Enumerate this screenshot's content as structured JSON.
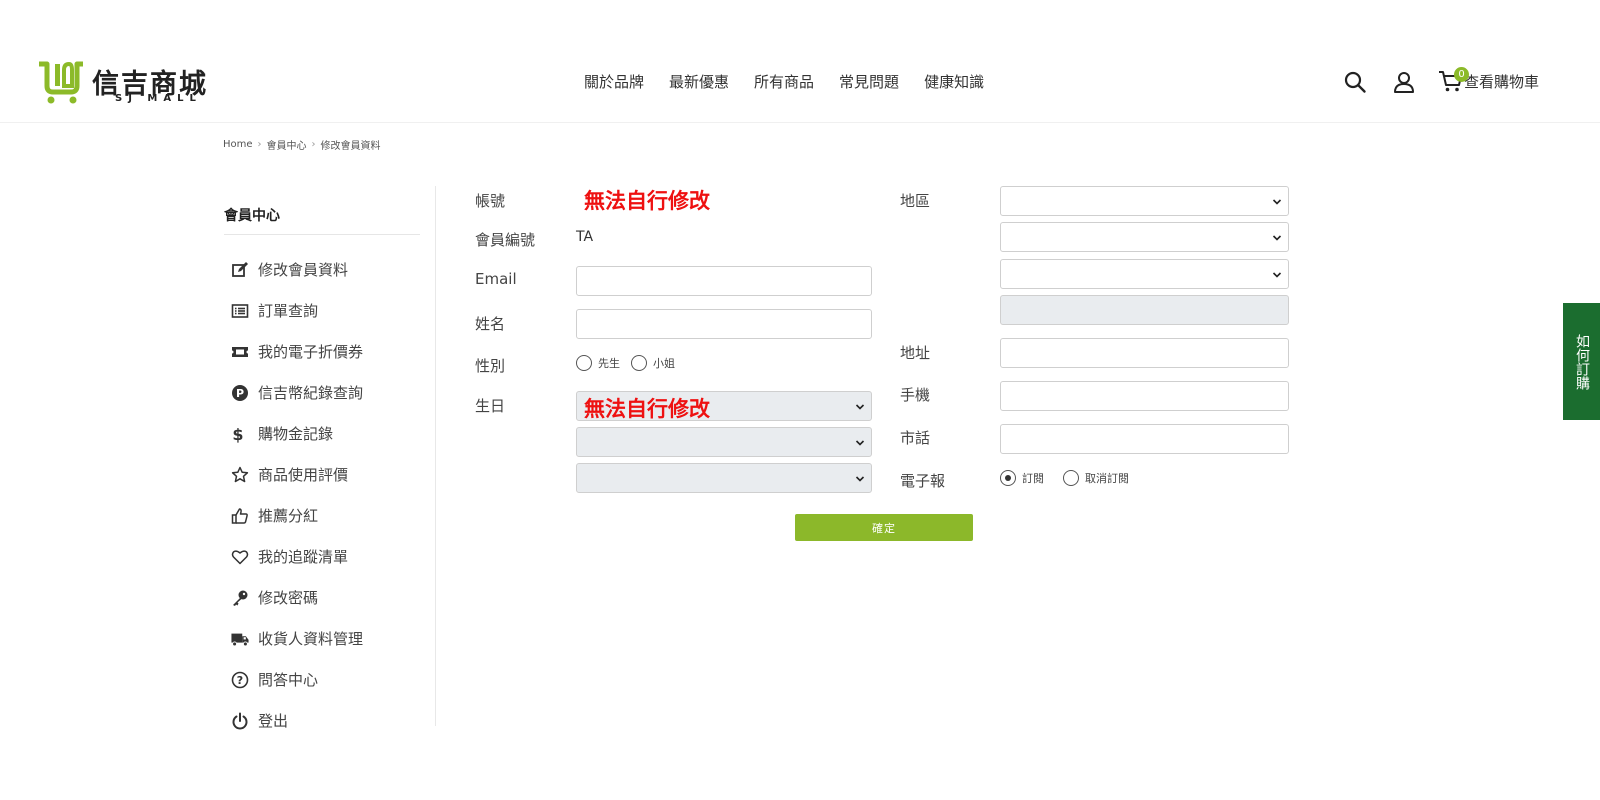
{
  "brand": {
    "name": "信吉商城",
    "sub": "SJ MALL",
    "color": "#8cba29"
  },
  "nav": [
    "關於品牌",
    "最新優惠",
    "所有商品",
    "常見問題",
    "健康知識"
  ],
  "header_icons": [
    "search-icon",
    "user-icon",
    "cart-icon"
  ],
  "cart": {
    "count": "0",
    "label": "查看購物車"
  },
  "breadcrumb": [
    "Home",
    "會員中心",
    "修改會員資料"
  ],
  "sidebar": {
    "title": "會員中心",
    "items": [
      {
        "label": "修改會員資料",
        "icon": "edit-icon"
      },
      {
        "label": "訂單查詢",
        "icon": "list-icon"
      },
      {
        "label": "我的電子折價券",
        "icon": "ticket-icon"
      },
      {
        "label": "信吉幣紀錄查詢",
        "icon": "coin-p-icon"
      },
      {
        "label": "購物金記錄",
        "icon": "dollar-icon"
      },
      {
        "label": "商品使用評價",
        "icon": "star-icon"
      },
      {
        "label": "推薦分紅",
        "icon": "thumbs-up-icon"
      },
      {
        "label": "我的追蹤清單",
        "icon": "heart-icon"
      },
      {
        "label": "修改密碼",
        "icon": "key-icon"
      },
      {
        "label": "收貨人資料管理",
        "icon": "truck-icon"
      },
      {
        "label": "問答中心",
        "icon": "question-icon"
      },
      {
        "label": "登出",
        "icon": "power-icon"
      }
    ]
  },
  "form": {
    "account_label": "帳號",
    "account_note": "無法自行修改",
    "member_no_label": "會員編號",
    "member_no_value": "TA",
    "email_label": "Email",
    "email_value": "",
    "name_label": "姓名",
    "name_value": "",
    "gender_label": "性別",
    "gender_options": [
      "先生",
      "小姐"
    ],
    "birthday_label": "生日",
    "birthday_note": "無法自行修改",
    "region_label": "地區",
    "address_label": "地址",
    "mobile_label": "手機",
    "phone_label": "市話",
    "newsletter_label": "電子報",
    "newsletter_options": [
      "訂閱",
      "取消訂閱"
    ],
    "newsletter_selected": "訂閱",
    "submit_label": "確定"
  },
  "side_tab": "如何訂購"
}
